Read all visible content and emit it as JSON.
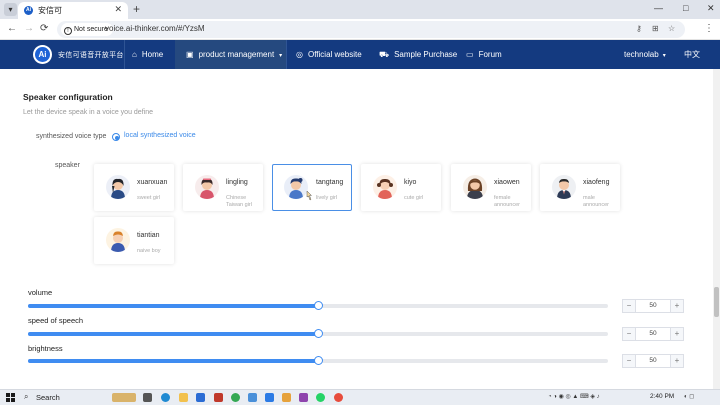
{
  "browser": {
    "tab_title": "安信可",
    "new_tab": "+",
    "not_secure": "Not secure",
    "url": "voice.ai-thinker.com/#/YzsM",
    "colors": {
      "nav_bg": "#143a80",
      "accent": "#3f8cf1"
    }
  },
  "nav": {
    "logo_text": "Ai",
    "brand": "安信可语音开放平台",
    "items": [
      {
        "label": "Home"
      },
      {
        "label": "product management"
      },
      {
        "label": "Official website"
      },
      {
        "label": "Sample Purchase"
      },
      {
        "label": "Forum"
      }
    ],
    "user": "technolab",
    "lang": "中文"
  },
  "config": {
    "title": "Speaker configuration",
    "subtitle": "Let the device speak in a voice you define",
    "voice_type_label": "synthesized voice type",
    "voice_type_value": "local synthesized voice",
    "speaker_label": "speaker",
    "speakers": [
      {
        "name": "xuanxuan",
        "desc": "sweet girl"
      },
      {
        "name": "lingling",
        "desc": "Chinese Taiwan girl"
      },
      {
        "name": "tangtang",
        "desc": "lively girl"
      },
      {
        "name": "kiyo",
        "desc": "cute girl"
      },
      {
        "name": "xiaowen",
        "desc": "female announcer"
      },
      {
        "name": "xiaofeng",
        "desc": "male announcer"
      },
      {
        "name": "tiantian",
        "desc": "naive boy"
      }
    ],
    "selected_speaker": "tangtang"
  },
  "sliders": [
    {
      "label": "volume",
      "value": "50",
      "fraction": 0.5
    },
    {
      "label": "speed of speech",
      "value": "50",
      "fraction": 0.5
    },
    {
      "label": "brightness",
      "value": "50",
      "fraction": 0.5
    }
  ],
  "stepper": {
    "minus": "−",
    "plus": "+"
  },
  "taskbar": {
    "search": "Search",
    "time": "2:40 PM"
  }
}
